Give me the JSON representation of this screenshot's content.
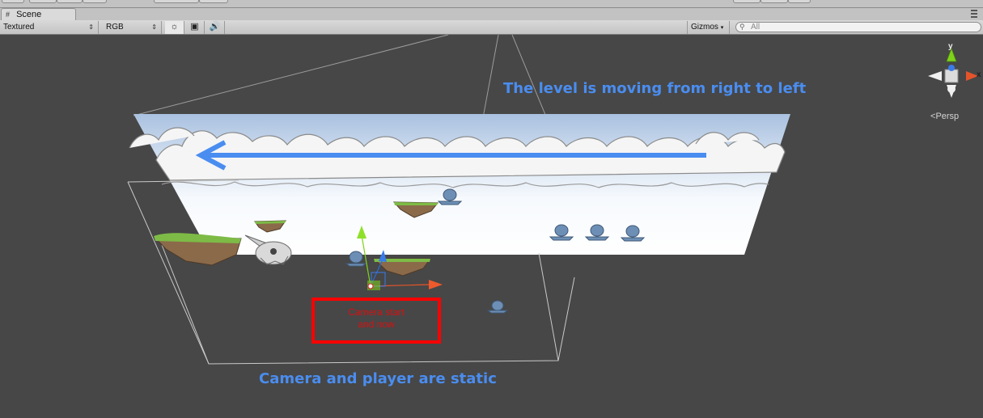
{
  "window": {
    "tab_label": "Scene"
  },
  "toolbar": {
    "render_mode": "Textured",
    "color_mode": "RGB",
    "icons": [
      "sun-icon",
      "image-icon",
      "audio-icon"
    ],
    "gizmos_label": "Gizmos",
    "search_value": "All"
  },
  "scene": {
    "annotation_top": "The level is moving from right to left",
    "annotation_bottom": "Camera and player are static",
    "camera_box_text": "Camera start\nand now",
    "orientation_gizmo": {
      "y_label": "y",
      "x_label": "x",
      "projection_label": "Persp"
    },
    "colors": {
      "annotation": "#4a8df0",
      "highlight_box": "#ff0000",
      "sky_top": "#a9c1e0",
      "sky_bottom": "#ffffff",
      "background": "#474747"
    }
  }
}
